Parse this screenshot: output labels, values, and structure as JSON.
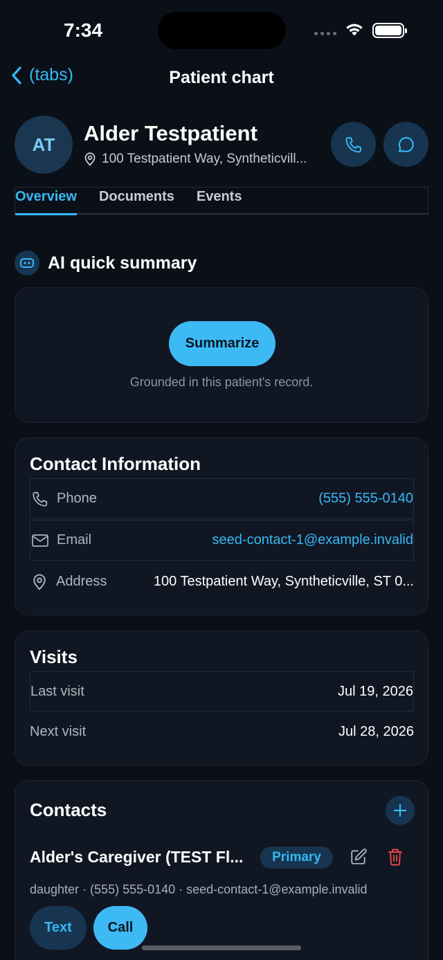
{
  "status_bar": {
    "time": "7:34"
  },
  "nav": {
    "back_label": "(tabs)",
    "title": "Patient chart"
  },
  "patient": {
    "initials": "AT",
    "name": "Alder Testpatient",
    "address": "100 Testpatient Way, Syntheticvill..."
  },
  "tabs": [
    {
      "label": "Overview",
      "active": true
    },
    {
      "label": "Documents",
      "active": false
    },
    {
      "label": "Events",
      "active": false
    }
  ],
  "ai_summary": {
    "title": "AI quick summary",
    "button_label": "Summarize",
    "note": "Grounded in this patient's record."
  },
  "contact_info": {
    "title": "Contact Information",
    "rows": [
      {
        "icon": "phone-icon",
        "label": "Phone",
        "value": "(555) 555-0140"
      },
      {
        "icon": "mail-icon",
        "label": "Email",
        "value": "seed-contact-1@example.invalid"
      },
      {
        "icon": "location-pin-icon",
        "label": "Address",
        "value": "100 Testpatient Way, Syntheticville, ST 0..."
      }
    ]
  },
  "visits": {
    "title": "Visits",
    "rows": [
      {
        "label": "Last visit",
        "value": "Jul 19, 2026"
      },
      {
        "label": "Next visit",
        "value": "Jul 28, 2026"
      }
    ]
  },
  "contacts": {
    "title": "Contacts",
    "items": [
      {
        "name": "Alder's Caregiver (TEST Fl...",
        "badge": "Primary",
        "meta": "daughter · (555) 555-0140 · seed-contact-1@example.invalid",
        "text_label": "Text",
        "call_label": "Call"
      }
    ]
  },
  "colors": {
    "background": "#0b1018",
    "card": "#111722",
    "accent": "#37b8f5",
    "accent_fill": "#3dbaf4",
    "icon_bg": "#173550",
    "danger": "#e5484d"
  }
}
